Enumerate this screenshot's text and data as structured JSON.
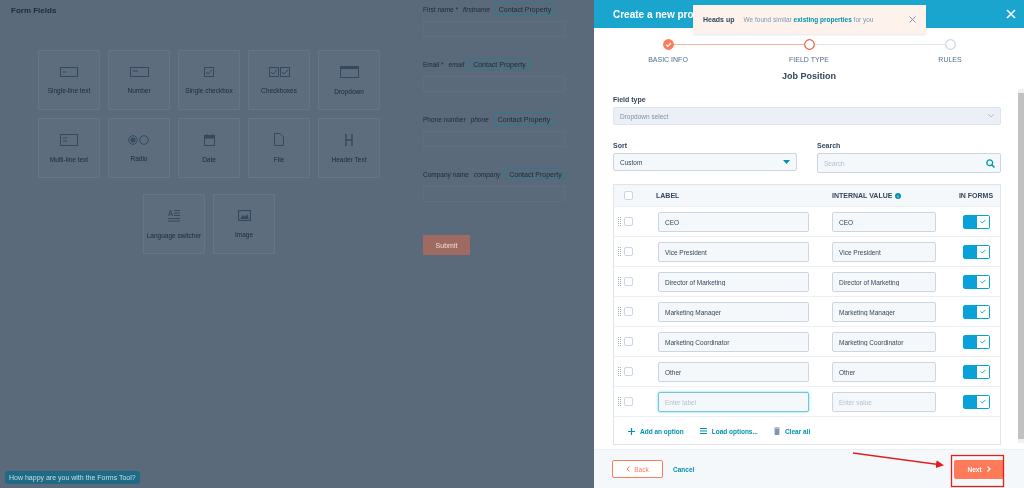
{
  "builder": {
    "title": "Form Fields",
    "field_tiles": [
      {
        "label": "Single-line text",
        "kind": "text"
      },
      {
        "label": "Number",
        "kind": "number"
      },
      {
        "label": "Single checkbox",
        "kind": "checkbox"
      },
      {
        "label": "Checkboxes",
        "kind": "checkboxes"
      },
      {
        "label": "Dropdown",
        "kind": "dropdown"
      },
      {
        "label": "Multi-line text",
        "kind": "multiline"
      },
      {
        "label": "Radio",
        "kind": "radio"
      },
      {
        "label": "Date",
        "kind": "date"
      },
      {
        "label": "File",
        "kind": "file"
      },
      {
        "label": "Header Text",
        "kind": "header"
      },
      {
        "label": "Language switcher",
        "kind": "paragraph"
      },
      {
        "label": "Image",
        "kind": "image"
      }
    ],
    "preview_fields": [
      {
        "label": "First name *",
        "internal_name": "firstname",
        "badge": "Contact Property"
      },
      {
        "label": "Email *",
        "internal_name": "email",
        "badge": "Contact Property"
      },
      {
        "label": "Phone number",
        "internal_name": "phone",
        "badge": "Contact Property"
      },
      {
        "label": "Company name",
        "internal_name": "company",
        "badge": "Contact Property"
      }
    ],
    "submit": "Submit",
    "feedback": "How happy are you with the Forms Tool?"
  },
  "modal": {
    "title": "Create a new pro",
    "toast": {
      "title": "Heads up",
      "before": "We found similar ",
      "link": "existing properties",
      "after": " for you"
    },
    "steps": [
      {
        "label": "BASIC INFO",
        "completed": true,
        "selected": false
      },
      {
        "label": "FIELD TYPE",
        "completed": false,
        "selected": true
      },
      {
        "label": "RULES",
        "completed": false,
        "selected": false
      }
    ],
    "heading": "Job Position",
    "field_type": {
      "label": "Field type",
      "value": "Dropdown select",
      "disabled": true
    },
    "sort": {
      "label": "Sort",
      "value": "Custom"
    },
    "search": {
      "label": "Search",
      "placeholder": "Search"
    },
    "columns": [
      {
        "label": "LABEL",
        "kind": "plain"
      },
      {
        "label": "INTERNAL VALUE",
        "kind": "help"
      },
      {
        "label": "IN FORMS",
        "kind": "plain"
      }
    ],
    "select_all": {
      "checked": false
    },
    "rows": [
      {
        "label": "CEO",
        "value": "CEO",
        "checked": false,
        "in_forms": true,
        "focused": false
      },
      {
        "label": "Vice President",
        "value": "Vice President",
        "checked": false,
        "in_forms": true,
        "focused": false
      },
      {
        "label": "Director of Marketing",
        "value": "Director of Marketing",
        "checked": false,
        "in_forms": true,
        "focused": false
      },
      {
        "label": "Marketing Manager",
        "value": "Marketing Manager",
        "checked": false,
        "in_forms": true,
        "focused": false
      },
      {
        "label": "Marketing Coordinator",
        "value": "Marketing Coordinator",
        "checked": false,
        "in_forms": true,
        "focused": false
      },
      {
        "label": "Other",
        "value": "Other",
        "checked": false,
        "in_forms": true,
        "focused": false
      },
      {
        "label_placeholder": "Enter label",
        "value_placeholder": "Enter value",
        "checked": false,
        "in_forms": true,
        "focused": true
      }
    ],
    "actions": [
      {
        "label": "Add an option",
        "kind": "add"
      },
      {
        "label": "Load options...",
        "kind": "load"
      },
      {
        "label": "Clear all",
        "kind": "clear"
      }
    ],
    "back": "Back",
    "cancel": "Cancel",
    "next": "Next"
  }
}
